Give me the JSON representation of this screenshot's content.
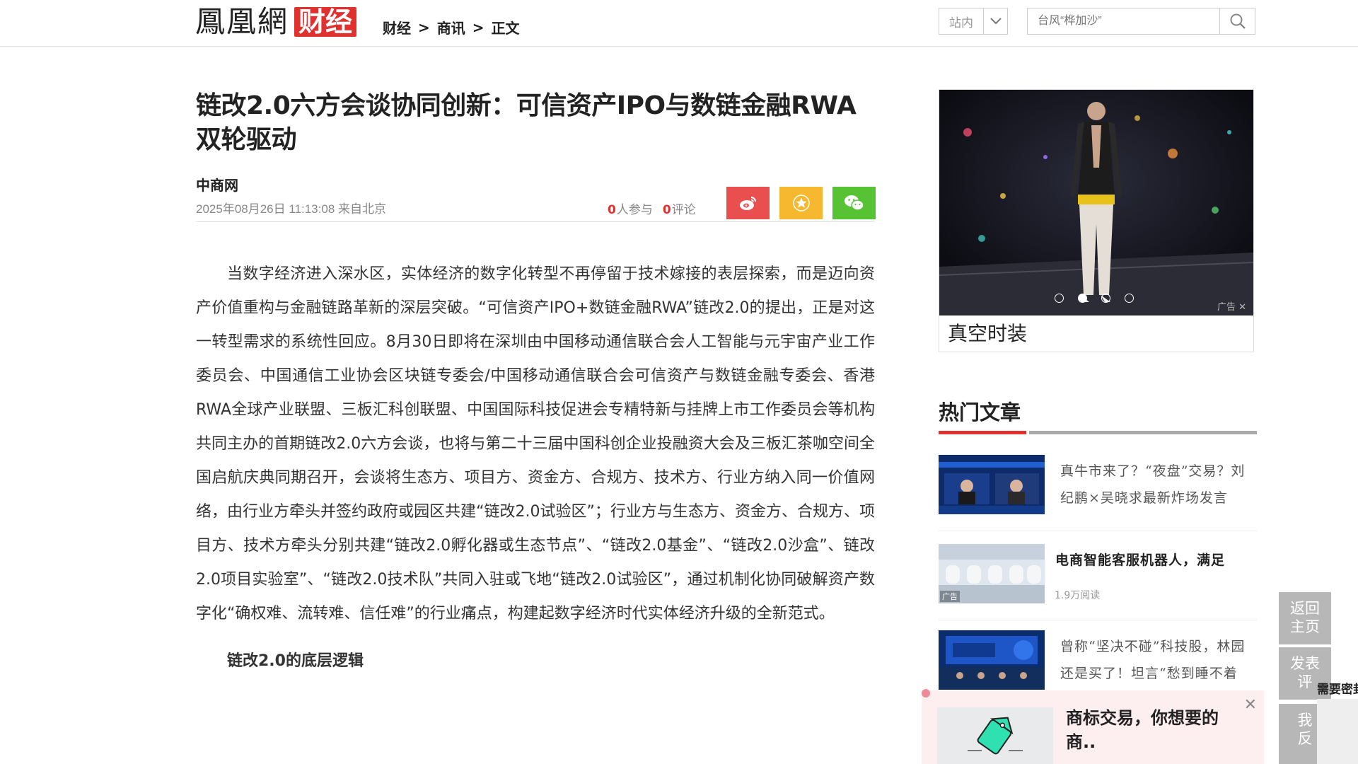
{
  "header": {
    "logo_main": "鳳凰網",
    "logo_sub": "财经",
    "breadcrumb": [
      "财经",
      "商讯",
      "正文"
    ],
    "breadcrumb_sep": ">",
    "site_select": "站内",
    "search_placeholder": "台风“桦加沙”"
  },
  "article": {
    "title": "链改2.0六方会谈协同创新：可信资产IPO与数链金融RWA双轮驱动",
    "source": "中商网",
    "datetime": "2025年08月26日 11:13:08 来自北京",
    "participants_num": "0",
    "participants_label": "人参与",
    "comments_num": "0",
    "comments_label": "评论",
    "paragraph1": "当数字经济进入深水区，实体经济的数字化转型不再停留于技术嫁接的表层探索，而是迈向资产价值重构与金融链路革新的深层突破。“可信资产IPO+数链金融RWA”链改2.0的提出，正是对这一转型需求的系统性回应。8月30日即将在深圳由中国移动通信联合会人工智能与元宇宙产业工作委员会、中国通信工业协会区块链专委会/中国移动通信联合会可信资产与数链金融专委会、香港RWA全球产业联盟、三板汇科创联盟、中国国际科技促进会专精特新与挂牌上市工作委员会等机构共同主办的首期链改2.0六方会谈，也将与第二十三届中国科创企业投融资大会及三板汇茶咖空间全国启航庆典同期召开，会谈将生态方、项目方、资金方、合规方、技术方、行业方纳入同一价值网络，由行业方牵头并签约政府或园区共建“链改2.0试验区”；行业方与生态方、资金方、合规方、项目方、技术方牵头分别共建“链改2.0孵化器或生态节点”、“链改2.0基金”、“链改2.0沙盒”、链改2.0项目实验室”、“链改2.0技术队”共同入驻或飞地“链改2.0试验区”，通过机制化协同破解资产数字化“确权难、流转难、信任难”的行业痛点，构建起数字经济时代实体经济升级的全新范式。",
    "subheading": "链改2.0的底层逻辑"
  },
  "sidebar": {
    "ad_caption": "真空时装",
    "ad_tag": "广告",
    "carousel_active": 2,
    "carousel_count": 4,
    "hot_title": "热门文章",
    "hot_items": [
      {
        "text": "真牛市来了？“夜盘”交易？刘纪鹏×吴晓求最新炸场发言"
      },
      {
        "text": "电商智能客服机器人，满足",
        "reads": "1.9万阅读",
        "ad": "广告"
      },
      {
        "text": "曾称“坚决不碰”科技股，林园还是买了！坦言“愁到睡不着觉”"
      }
    ]
  },
  "float_tools": {
    "back_home": "返回\n主页",
    "comment": "发表\n评",
    "feedback": "我\n反"
  },
  "popup": {
    "text": "商标交易，你想要的商..",
    "edge_label": "需要密封"
  },
  "colors": {
    "brand_red": "#e0312f",
    "weibo": "#ea4f4f",
    "favorite": "#f5b82e",
    "wechat": "#57c233"
  },
  "icons": [
    "chevron-down-icon",
    "search-icon",
    "weibo-icon",
    "star-icon",
    "wechat-icon",
    "close-icon",
    "tag-icon"
  ]
}
